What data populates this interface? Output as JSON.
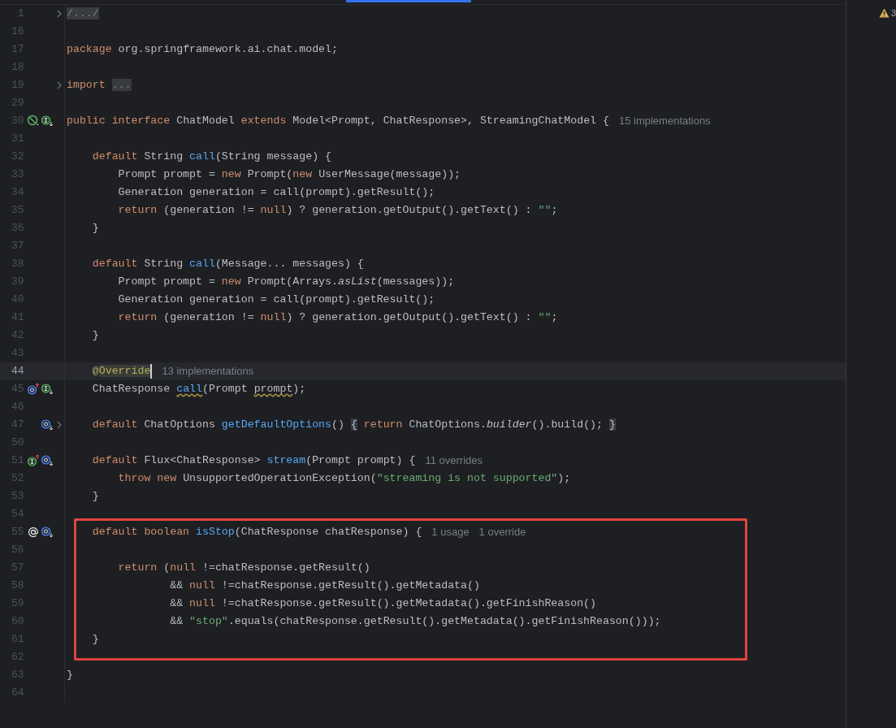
{
  "warnings": {
    "count": "3"
  },
  "sections": [
    {
      "highlighted": false,
      "lines": [
        {
          "number": "1",
          "current": false,
          "fold": true,
          "tokens": [
            {
              "kind": "fold",
              "text": "/.../"
            }
          ]
        },
        {
          "number": "16",
          "current": false,
          "fold": false
        },
        {
          "number": "17",
          "current": false,
          "fold": false,
          "tokens": [
            {
              "kind": "keyword",
              "text": "package"
            },
            {
              "kind": "plain",
              "text": " org.springframework.ai.chat.model;"
            }
          ]
        },
        {
          "number": "18",
          "current": false,
          "fold": false
        },
        {
          "number": "19",
          "current": false,
          "fold": true,
          "tokens": [
            {
              "kind": "keyword",
              "text": "import "
            },
            {
              "kind": "fold",
              "text": "..."
            }
          ]
        },
        {
          "number": "29",
          "current": false,
          "fold": false
        },
        {
          "number": "30",
          "current": false,
          "fold": false,
          "icons": [
            {
              "kind": "slashed"
            },
            {
              "kind": "interface-down"
            }
          ],
          "hints": [
            "15 implementations"
          ],
          "tokens": [
            {
              "kind": "keyword",
              "text": "public interface"
            },
            {
              "kind": "plain",
              "text": " ChatModel "
            },
            {
              "kind": "keyword",
              "text": "extends"
            },
            {
              "kind": "plain",
              "text": " Model<Prompt, ChatResponse>, StreamingChatModel {"
            }
          ]
        },
        {
          "number": "31",
          "current": false,
          "fold": false
        },
        {
          "number": "32",
          "current": false,
          "fold": false,
          "tokens": [
            {
              "kind": "keyword",
              "text": "    default"
            },
            {
              "kind": "plain",
              "text": " String "
            },
            {
              "kind": "method",
              "text": "call"
            },
            {
              "kind": "plain",
              "text": "(String message) {"
            }
          ]
        },
        {
          "number": "33",
          "current": false,
          "fold": false,
          "tokens": [
            {
              "kind": "plain",
              "text": "        Prompt prompt = "
            },
            {
              "kind": "keyword",
              "text": "new"
            },
            {
              "kind": "plain",
              "text": " Prompt("
            },
            {
              "kind": "keyword",
              "text": "new"
            },
            {
              "kind": "plain",
              "text": " UserMessage(message));"
            }
          ]
        },
        {
          "number": "34",
          "current": false,
          "fold": false,
          "tokens": [
            {
              "kind": "plain",
              "text": "        Generation generation = call(prompt).getResult();"
            }
          ]
        },
        {
          "number": "35",
          "current": false,
          "fold": false,
          "tokens": [
            {
              "kind": "keyword",
              "text": "        return"
            },
            {
              "kind": "plain",
              "text": " (generation != "
            },
            {
              "kind": "keyword",
              "text": "null"
            },
            {
              "kind": "plain",
              "text": ") ? generation.getOutput().getText() : "
            },
            {
              "kind": "string",
              "text": "\"\""
            },
            {
              "kind": "plain",
              "text": ";"
            }
          ]
        },
        {
          "number": "36",
          "current": false,
          "fold": false,
          "tokens": [
            {
              "kind": "plain",
              "text": "    }"
            }
          ]
        },
        {
          "number": "37",
          "current": false,
          "fold": false
        },
        {
          "number": "38",
          "current": false,
          "fold": false,
          "tokens": [
            {
              "kind": "keyword",
              "text": "    default"
            },
            {
              "kind": "plain",
              "text": " String "
            },
            {
              "kind": "method",
              "text": "call"
            },
            {
              "kind": "plain",
              "text": "(Message... messages) {"
            }
          ]
        },
        {
          "number": "39",
          "current": false,
          "fold": false,
          "tokens": [
            {
              "kind": "plain",
              "text": "        Prompt prompt = "
            },
            {
              "kind": "keyword",
              "text": "new"
            },
            {
              "kind": "plain",
              "text": " Prompt(Arrays."
            },
            {
              "kind": "italic",
              "text": "asList"
            },
            {
              "kind": "plain",
              "text": "(messages));"
            }
          ]
        },
        {
          "number": "40",
          "current": false,
          "fold": false,
          "tokens": [
            {
              "kind": "plain",
              "text": "        Generation generation = call(prompt).getResult();"
            }
          ]
        },
        {
          "number": "41",
          "current": false,
          "fold": false,
          "tokens": [
            {
              "kind": "keyword",
              "text": "        return"
            },
            {
              "kind": "plain",
              "text": " (generation != "
            },
            {
              "kind": "keyword",
              "text": "null"
            },
            {
              "kind": "plain",
              "text": ") ? generation.getOutput().getText() : "
            },
            {
              "kind": "string",
              "text": "\"\""
            },
            {
              "kind": "plain",
              "text": ";"
            }
          ]
        },
        {
          "number": "42",
          "current": false,
          "fold": false,
          "tokens": [
            {
              "kind": "plain",
              "text": "    }"
            }
          ]
        },
        {
          "number": "43",
          "current": false,
          "fold": false
        },
        {
          "number": "44",
          "current": true,
          "fold": false,
          "hints": [
            "13 implementations"
          ],
          "tokens": [
            {
              "kind": "annotation",
              "text": "    @"
            },
            {
              "kind": "annotation-match",
              "text": "Override"
            }
          ]
        },
        {
          "number": "45",
          "current": false,
          "fold": false,
          "icons": [
            {
              "kind": "override-up"
            },
            {
              "kind": "interface-down"
            }
          ],
          "tokens": [
            {
              "kind": "plain",
              "text": "    ChatResponse "
            },
            {
              "kind": "method-warn",
              "text": "call"
            },
            {
              "kind": "plain",
              "text": "(Prompt "
            },
            {
              "kind": "plain-warn",
              "text": "prompt"
            },
            {
              "kind": "plain",
              "text": ");"
            }
          ]
        },
        {
          "number": "46",
          "current": false,
          "fold": false
        },
        {
          "number": "47",
          "current": false,
          "fold": true,
          "icons": [
            {
              "kind": "method-down"
            }
          ],
          "tokens": [
            {
              "kind": "keyword",
              "text": "    default"
            },
            {
              "kind": "plain",
              "text": " ChatOptions "
            },
            {
              "kind": "method",
              "text": "getDefaultOptions"
            },
            {
              "kind": "plain",
              "text": "() "
            },
            {
              "kind": "fold-brace",
              "text": "{"
            },
            {
              "kind": "keyword",
              "text": " return"
            },
            {
              "kind": "plain",
              "text": " ChatOptions."
            },
            {
              "kind": "italic",
              "text": "builder"
            },
            {
              "kind": "plain",
              "text": "().build(); "
            },
            {
              "kind": "fold-brace",
              "text": "}"
            }
          ]
        },
        {
          "number": "50",
          "current": false,
          "fold": false
        },
        {
          "number": "51",
          "current": false,
          "fold": false,
          "icons": [
            {
              "kind": "implementer-up"
            },
            {
              "kind": "method-down"
            }
          ],
          "hints": [
            "11 overrides"
          ],
          "tokens": [
            {
              "kind": "keyword",
              "text": "    default"
            },
            {
              "kind": "plain",
              "text": " Flux<ChatResponse> "
            },
            {
              "kind": "method",
              "text": "stream"
            },
            {
              "kind": "plain",
              "text": "(Prompt prompt) {"
            }
          ]
        },
        {
          "number": "52",
          "current": false,
          "fold": false,
          "tokens": [
            {
              "kind": "keyword",
              "text": "        throw new"
            },
            {
              "kind": "plain",
              "text": " UnsupportedOperationException("
            },
            {
              "kind": "string",
              "text": "\"streaming is not supported\""
            },
            {
              "kind": "plain",
              "text": ");"
            }
          ]
        },
        {
          "number": "53",
          "current": false,
          "fold": false,
          "tokens": [
            {
              "kind": "plain",
              "text": "    }"
            }
          ]
        },
        {
          "number": "54",
          "current": false,
          "fold": false
        }
      ]
    },
    {
      "highlighted": true,
      "lines": [
        {
          "number": "55",
          "current": false,
          "fold": false,
          "icons": [
            {
              "kind": "at"
            },
            {
              "kind": "method-down"
            }
          ],
          "hints": [
            "1 usage",
            "1 override"
          ],
          "tokens": [
            {
              "kind": "keyword",
              "text": "    default boolean"
            },
            {
              "kind": "method",
              "text": " isStop"
            },
            {
              "kind": "plain",
              "text": "(ChatResponse chatResponse) {"
            }
          ]
        },
        {
          "number": "56",
          "current": false,
          "fold": false
        },
        {
          "number": "57",
          "current": false,
          "fold": false,
          "tokens": [
            {
              "kind": "keyword",
              "text": "        return"
            },
            {
              "kind": "plain",
              "text": " ("
            },
            {
              "kind": "keyword",
              "text": "null"
            },
            {
              "kind": "plain",
              "text": " !=chatResponse.getResult()"
            }
          ]
        },
        {
          "number": "58",
          "current": false,
          "fold": false,
          "tokens": [
            {
              "kind": "plain",
              "text": "                && "
            },
            {
              "kind": "keyword",
              "text": "null"
            },
            {
              "kind": "plain",
              "text": " !=chatResponse.getResult().getMetadata()"
            }
          ]
        },
        {
          "number": "59",
          "current": false,
          "fold": false,
          "tokens": [
            {
              "kind": "plain",
              "text": "                && "
            },
            {
              "kind": "keyword",
              "text": "null"
            },
            {
              "kind": "plain",
              "text": " !=chatResponse.getResult().getMetadata().getFinishReason()"
            }
          ]
        },
        {
          "number": "60",
          "current": false,
          "fold": false,
          "tokens": [
            {
              "kind": "plain",
              "text": "                && "
            },
            {
              "kind": "string",
              "text": "\"stop\""
            },
            {
              "kind": "plain",
              "text": ".equals(chatResponse.getResult().getMetadata().getFinishReason()));"
            }
          ]
        },
        {
          "number": "61",
          "current": false,
          "fold": false,
          "tokens": [
            {
              "kind": "plain",
              "text": "    }"
            }
          ]
        }
      ]
    },
    {
      "highlighted": false,
      "lines": [
        {
          "number": "62",
          "current": false,
          "fold": false
        },
        {
          "number": "63",
          "current": false,
          "fold": false,
          "tokens": [
            {
              "kind": "plain",
              "text": "}"
            }
          ]
        },
        {
          "number": "64",
          "current": false,
          "fold": false
        }
      ]
    }
  ]
}
